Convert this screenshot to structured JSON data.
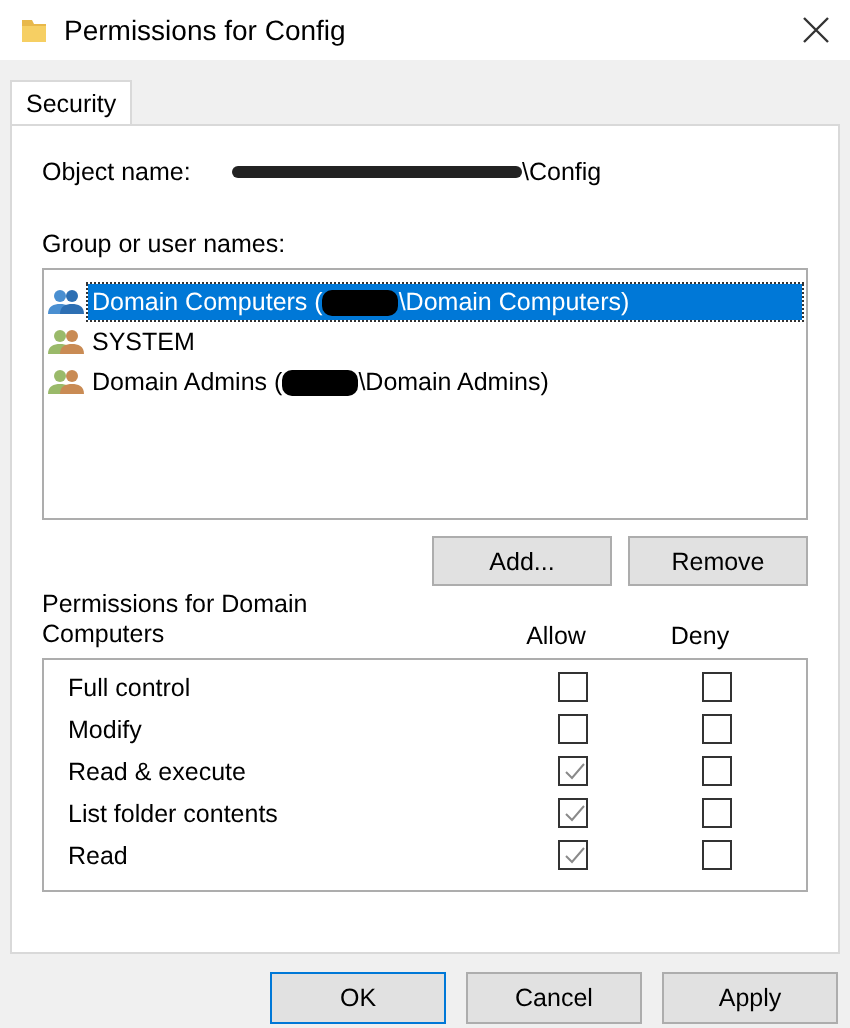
{
  "window": {
    "title": "Permissions for Config"
  },
  "tabs": [
    {
      "label": "Security",
      "selected": true
    }
  ],
  "object_name": {
    "label": "Object name:",
    "redacted": true,
    "value": "\\Config"
  },
  "groups": {
    "label": "Group or user names:",
    "items": [
      {
        "before": "Domain Computers (",
        "redacted": true,
        "after": "\\Domain Computers)",
        "selected": true
      },
      {
        "before": "SYSTEM",
        "redacted": false,
        "selected": false
      },
      {
        "before": "Domain Admins (",
        "redacted": true,
        "after": "\\Domain Admins)",
        "selected": false
      }
    ]
  },
  "group_buttons": [
    "Add...",
    "Remove"
  ],
  "permissions": {
    "label": "Permissions for Domain Computers",
    "allow_header": "Allow",
    "deny_header": "Deny",
    "rows": [
      {
        "name": "Full control",
        "allow": false,
        "deny": false
      },
      {
        "name": "Modify",
        "allow": false,
        "deny": false
      },
      {
        "name": "Read & execute",
        "allow": true,
        "deny": false
      },
      {
        "name": "List folder contents",
        "allow": true,
        "deny": false
      },
      {
        "name": "Read",
        "allow": true,
        "deny": false
      }
    ]
  },
  "buttons": [
    {
      "label": "OK",
      "default": true
    },
    {
      "label": "Cancel",
      "default": false
    },
    {
      "label": "Apply",
      "default": false
    }
  ]
}
